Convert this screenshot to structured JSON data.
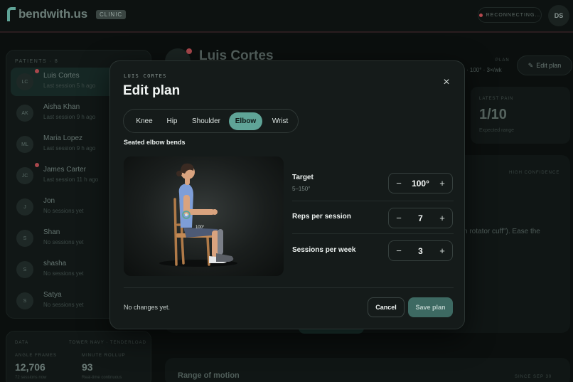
{
  "app": {
    "name": "bendwith.us",
    "badge": "CLINIC"
  },
  "header": {
    "connection_status": "RECONNECTING…",
    "user_initials": "DS"
  },
  "sidebar": {
    "heading": "PATIENTS · 8",
    "patients": [
      {
        "initials": "LC",
        "name": "Luis Cortes",
        "sub": "Last session 5 h ago",
        "alert": true
      },
      {
        "initials": "AK",
        "name": "Aisha Khan",
        "sub": "Last session 9 h ago",
        "alert": false
      },
      {
        "initials": "ML",
        "name": "Maria Lopez",
        "sub": "Last session 9 h ago",
        "alert": false
      },
      {
        "initials": "JC",
        "name": "James Carter",
        "sub": "Last session 11 h ago",
        "alert": true
      },
      {
        "initials": "J",
        "name": "Jon",
        "sub": "No sessions yet",
        "alert": false
      },
      {
        "initials": "S",
        "name": "Shan",
        "sub": "No sessions yet",
        "alert": false
      },
      {
        "initials": "S",
        "name": "shasha",
        "sub": "No sessions yet",
        "alert": false
      },
      {
        "initials": "S",
        "name": "Satya",
        "sub": "No sessions yet",
        "alert": false
      }
    ]
  },
  "stats": {
    "label_left": "DATA",
    "label_right": "TOWER NAVY · TENDERLOAD",
    "angle_frames_label": "ANGLE FRAMES",
    "angle_frames_value": "12,706",
    "angle_frames_sub": "72 sessions now",
    "minute_rollup_label": "MINUTE ROLLUP",
    "minute_rollup_value": "93",
    "minute_rollup_sub": "Real-time continuous"
  },
  "main": {
    "patient_name": "Luis Cortes",
    "plan_label": "PLAN",
    "plan_summary": "· 100° · 3×/wk",
    "edit_plan_label": "Edit plan",
    "latest_label": "LATEST PAIN",
    "latest_value": "1/10",
    "latest_sub": "Expected range",
    "confidence_label": "HIGH CONFIDENCE",
    "note_fragment": "n rotator cuff\"). Ease the",
    "rom_title": "Range of motion",
    "rom_right": "SINCE SEP 30"
  },
  "modal": {
    "eyebrow": "LUIS CORTES",
    "title": "Edit plan",
    "close_glyph": "×",
    "tabs": [
      {
        "label": "Knee",
        "active": false
      },
      {
        "label": "Hip",
        "active": false
      },
      {
        "label": "Shoulder",
        "active": false
      },
      {
        "label": "Elbow",
        "active": true
      },
      {
        "label": "Wrist",
        "active": false
      }
    ],
    "exercise_name": "Seated elbow bends",
    "preview_angle": "100°",
    "controls": [
      {
        "label": "Target",
        "range": "5–150°",
        "value": "100°"
      },
      {
        "label": "Reps per session",
        "range": "",
        "value": "7"
      },
      {
        "label": "Sessions per week",
        "range": "",
        "value": "3"
      }
    ],
    "minus_glyph": "−",
    "plus_glyph": "+",
    "status": "No changes yet.",
    "cancel_label": "Cancel",
    "save_label": "Save plan"
  },
  "colors": {
    "accent": "#5fa497",
    "save_button": "#3d6962",
    "alert_dot": "#a8474c",
    "modal_bg": "#151b1a"
  },
  "icons": [
    "logo-mark-icon",
    "close-icon",
    "minus-icon",
    "plus-icon",
    "pencil-icon",
    "status-dot-icon"
  ]
}
